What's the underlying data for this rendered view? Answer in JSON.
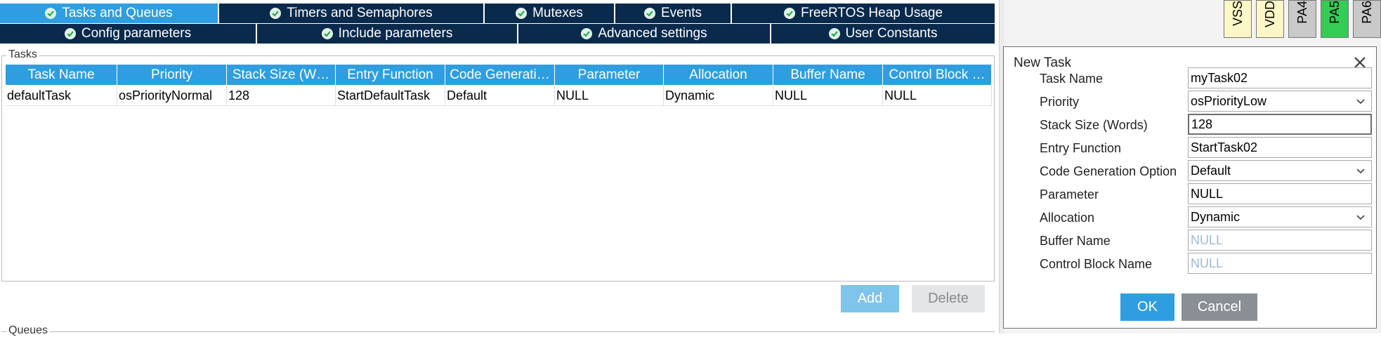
{
  "tabs_row1": [
    {
      "label": "Tasks and Queues",
      "active": true
    },
    {
      "label": "Timers and Semaphores",
      "active": false
    },
    {
      "label": "Mutexes",
      "active": false
    },
    {
      "label": "Events",
      "active": false
    },
    {
      "label": "FreeRTOS Heap Usage",
      "active": false
    }
  ],
  "tabs_row2": [
    {
      "label": "Config parameters"
    },
    {
      "label": "Include parameters"
    },
    {
      "label": "Advanced settings"
    },
    {
      "label": "User Constants"
    }
  ],
  "tasks": {
    "legend": "Tasks",
    "columns": [
      "Task Name",
      "Priority",
      "Stack Size (W…",
      "Entry Function",
      "Code Generati…",
      "Parameter",
      "Allocation",
      "Buffer Name",
      "Control Block …"
    ],
    "rows": [
      [
        "defaultTask",
        "osPriorityNormal",
        "128",
        "StartDefaultTask",
        "Default",
        "NULL",
        "Dynamic",
        "NULL",
        "NULL"
      ]
    ],
    "add_label": "Add",
    "delete_label": "Delete"
  },
  "queues": {
    "legend": "Queues"
  },
  "pins": [
    {
      "label": "VSS",
      "color": "#fdf6c8"
    },
    {
      "label": "VDD",
      "color": "#fdf6c8"
    },
    {
      "label": "PA4",
      "color": "#c9c9c9"
    },
    {
      "label": "PA5",
      "color": "#33cc55"
    },
    {
      "label": "PA6",
      "color": "#c9c9c9"
    }
  ],
  "dialog": {
    "title": "New Task",
    "fields": [
      {
        "label": "Task Name",
        "value": "myTask02",
        "type": "text"
      },
      {
        "label": "Priority",
        "value": "osPriorityLow",
        "type": "select"
      },
      {
        "label": "Stack Size (Words)",
        "value": "128",
        "type": "text",
        "focused": true
      },
      {
        "label": "Entry Function",
        "value": "StartTask02",
        "type": "text"
      },
      {
        "label": "Code Generation Option",
        "value": "Default",
        "type": "select"
      },
      {
        "label": "Parameter",
        "value": "NULL",
        "type": "text"
      },
      {
        "label": "Allocation",
        "value": "Dynamic",
        "type": "select"
      },
      {
        "label": "Buffer Name",
        "value": "NULL",
        "type": "text",
        "placeholder": true
      },
      {
        "label": "Control Block Name",
        "value": "NULL",
        "type": "text",
        "placeholder": true
      }
    ],
    "ok_label": "OK",
    "cancel_label": "Cancel"
  },
  "colors": {
    "tab_bg": "#0a2a4c",
    "accent": "#2f9ee0",
    "ok": "#2f9ee0",
    "cancel": "#8a8f94"
  }
}
